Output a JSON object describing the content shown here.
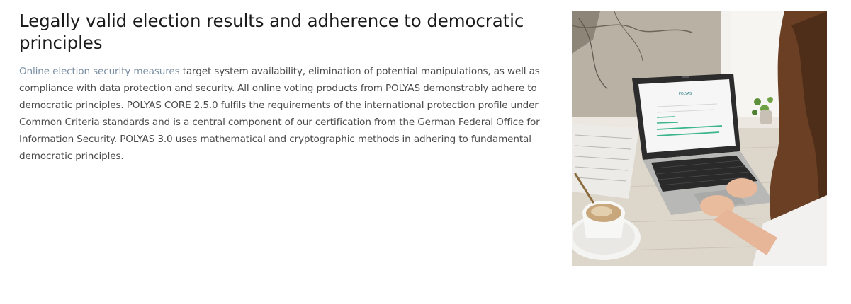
{
  "section": {
    "title": "Legally valid election results and adherence to democratic principles",
    "body": {
      "link_text": "Online election security measures",
      "rest": " target system availability, elimination of potential manipulations, as well as compliance with data protection and security. All online voting products from POLYAS demonstrably adhere to democratic principles. POLYAS CORE 2.5.0 fulfils the requirements of the international protection profile under Common Criteria standards and is a central component of our certification from the German Federal Office for Information Security. POLYAS 3.0 uses mathematical and cryptographic methods in adhering to fundamental democratic principles."
    }
  },
  "image": {
    "screen_brand": "POLYAS"
  },
  "colors": {
    "link": "#7b8fa3",
    "heading": "#1a1a1a",
    "body": "#4a4a4a",
    "screen_accent": "#3bb58a"
  }
}
